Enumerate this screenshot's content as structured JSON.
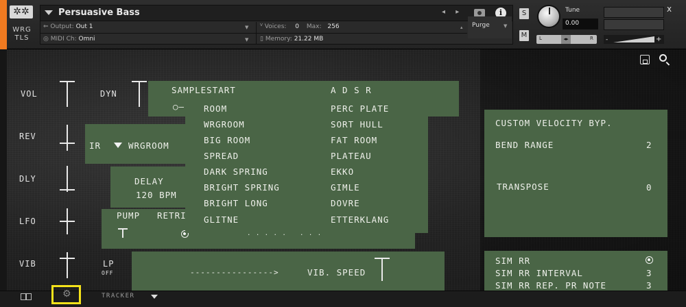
{
  "header": {
    "logo_glyph": "✲✲",
    "logo_text_1": "WRG",
    "logo_text_2": "TLS",
    "instrument_name": "Persuasive Bass",
    "output_label": "Output:",
    "output_value": "Out 1",
    "midi_label": "MIDI Ch:",
    "midi_value": "Omni",
    "voices_label": "Voices:",
    "voices_value": "0",
    "max_label": "Max:",
    "max_value": "256",
    "memory_label": "Memory:",
    "memory_value": "21.22 MB",
    "purge_label": "Purge",
    "info_glyph": "i",
    "s_button": "S",
    "m_button": "M",
    "tune_label": "Tune",
    "tune_value": "0.00",
    "pan_l": "L",
    "pan_r": "R",
    "vol_minus": "-",
    "vol_plus": "+",
    "close_glyph": "x"
  },
  "left_controls": {
    "vol": "VOL",
    "dyn": "DYN",
    "rev": "REV",
    "dly": "DLY",
    "lfo": "LFO",
    "vib": "VIB",
    "lp": "LP",
    "lp_state": "OFF"
  },
  "sample_panel": {
    "samplestart": "SAMPLESTART",
    "adsr": "A  D  S  R",
    "line_glyph": "○—"
  },
  "reverb": {
    "ir_label": "IR",
    "ir_value": "WRGROOM",
    "options_col1": [
      "ROOM",
      "WRGROOM",
      "BIG ROOM",
      "SPREAD",
      "DARK SPRING",
      "BRIGHT SPRING",
      "BRIGHT LONG",
      "GLITNE"
    ],
    "options_col2": [
      "PERC PLATE",
      "SORT HULL",
      "FAT ROOM",
      "PLATEAU",
      "EKKO",
      "GIMLE",
      "DOVRE",
      "ETTERKLANG"
    ]
  },
  "delay": {
    "label": "DELAY",
    "tempo": "120 BPM"
  },
  "lfo_panel": {
    "pump": "PUMP",
    "retri": "RETRI",
    "dots": ". . .   . .   ˘   . . ."
  },
  "vib_panel": {
    "arrow": "---------------->",
    "speed_label": "VIB. SPEED"
  },
  "right_panel": {
    "custom_velocity": "CUSTOM VELOCITY BYP.",
    "bend_range_label": "BEND RANGE",
    "bend_range_value": "2",
    "transpose_label": "TRANSPOSE",
    "transpose_value": "0"
  },
  "sim_panel": {
    "sim_rr_label": "SIM RR",
    "interval_label": "SIM RR INTERVAL",
    "interval_value": "3",
    "rep_label": "SIM RR REP. PR NOTE",
    "rep_value": "3"
  },
  "bottom_bar": {
    "gear_glyph": "⚙",
    "tracker_label": "TRACKER"
  },
  "colors": {
    "panel_green": "#4a6546",
    "header_accent": "#f07a20",
    "highlight_yellow": "#f5e21a"
  }
}
